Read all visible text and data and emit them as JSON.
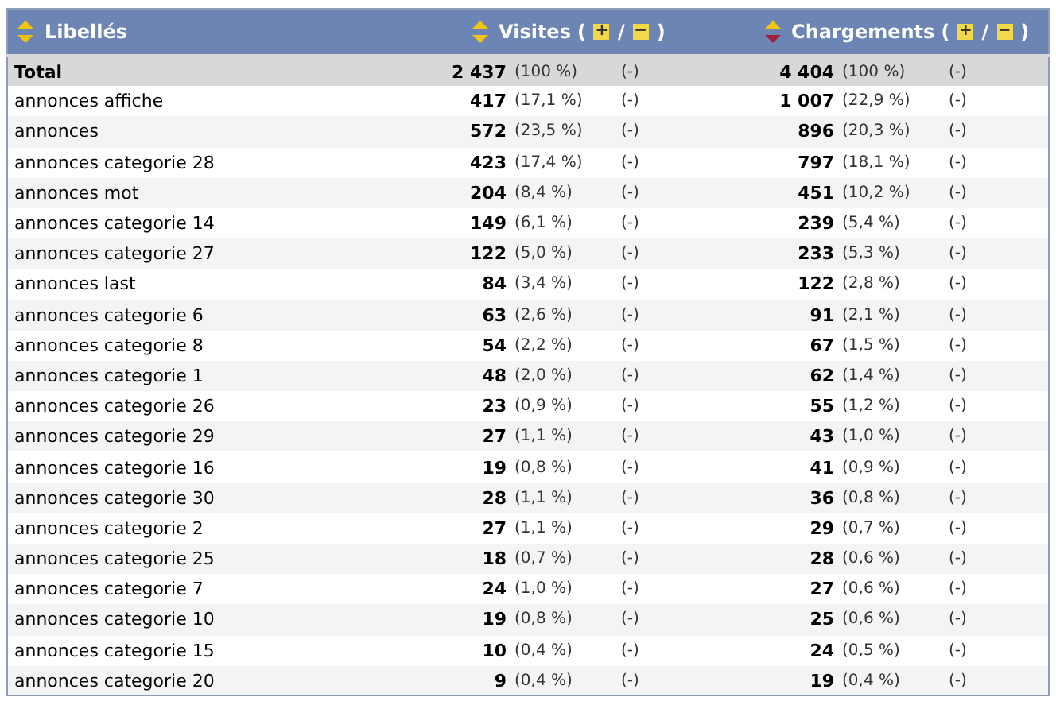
{
  "table": {
    "columns": [
      {
        "label": "Libellés",
        "sorted": false
      },
      {
        "label": "Visites",
        "sorted": false,
        "bracket_open": "(",
        "expand": "+",
        "separator": "/",
        "collapse": "−",
        "bracket_close": ")"
      },
      {
        "label": "Chargements",
        "sorted": true,
        "bracket_open": "(",
        "expand": "+",
        "separator": "/",
        "collapse": "−",
        "bracket_close": ")"
      }
    ],
    "rows": [
      {
        "kind": "total",
        "label": "Total",
        "visits": "2 437",
        "visits_pct": "(100 %)",
        "visits_delta": "(-)",
        "loads": "4 404",
        "loads_pct": "(100 %)",
        "loads_delta": "(-)"
      },
      {
        "kind": "item",
        "label": "annonces affiche",
        "visits": "417",
        "visits_pct": "(17,1 %)",
        "visits_delta": "(-)",
        "loads": "1 007",
        "loads_pct": "(22,9 %)",
        "loads_delta": "(-)"
      },
      {
        "kind": "item",
        "label": "annonces",
        "visits": "572",
        "visits_pct": "(23,5 %)",
        "visits_delta": "(-)",
        "loads": "896",
        "loads_pct": "(20,3 %)",
        "loads_delta": "(-)"
      },
      {
        "kind": "item",
        "label": "annonces categorie 28",
        "visits": "423",
        "visits_pct": "(17,4 %)",
        "visits_delta": "(-)",
        "loads": "797",
        "loads_pct": "(18,1 %)",
        "loads_delta": "(-)"
      },
      {
        "kind": "item",
        "label": "annonces mot",
        "visits": "204",
        "visits_pct": "(8,4 %)",
        "visits_delta": "(-)",
        "loads": "451",
        "loads_pct": "(10,2 %)",
        "loads_delta": "(-)"
      },
      {
        "kind": "item",
        "label": "annonces categorie 14",
        "visits": "149",
        "visits_pct": "(6,1 %)",
        "visits_delta": "(-)",
        "loads": "239",
        "loads_pct": "(5,4 %)",
        "loads_delta": "(-)"
      },
      {
        "kind": "item",
        "label": "annonces categorie 27",
        "visits": "122",
        "visits_pct": "(5,0 %)",
        "visits_delta": "(-)",
        "loads": "233",
        "loads_pct": "(5,3 %)",
        "loads_delta": "(-)"
      },
      {
        "kind": "item",
        "label": "annonces last",
        "visits": "84",
        "visits_pct": "(3,4 %)",
        "visits_delta": "(-)",
        "loads": "122",
        "loads_pct": "(2,8 %)",
        "loads_delta": "(-)"
      },
      {
        "kind": "item",
        "label": "annonces categorie 6",
        "visits": "63",
        "visits_pct": "(2,6 %)",
        "visits_delta": "(-)",
        "loads": "91",
        "loads_pct": "(2,1 %)",
        "loads_delta": "(-)"
      },
      {
        "kind": "item",
        "label": "annonces categorie 8",
        "visits": "54",
        "visits_pct": "(2,2 %)",
        "visits_delta": "(-)",
        "loads": "67",
        "loads_pct": "(1,5 %)",
        "loads_delta": "(-)"
      },
      {
        "kind": "item",
        "label": "annonces categorie 1",
        "visits": "48",
        "visits_pct": "(2,0 %)",
        "visits_delta": "(-)",
        "loads": "62",
        "loads_pct": "(1,4 %)",
        "loads_delta": "(-)"
      },
      {
        "kind": "item",
        "label": "annonces categorie 26",
        "visits": "23",
        "visits_pct": "(0,9 %)",
        "visits_delta": "(-)",
        "loads": "55",
        "loads_pct": "(1,2 %)",
        "loads_delta": "(-)"
      },
      {
        "kind": "item",
        "label": "annonces categorie 29",
        "visits": "27",
        "visits_pct": "(1,1 %)",
        "visits_delta": "(-)",
        "loads": "43",
        "loads_pct": "(1,0 %)",
        "loads_delta": "(-)"
      },
      {
        "kind": "item",
        "label": "annonces categorie 16",
        "visits": "19",
        "visits_pct": "(0,8 %)",
        "visits_delta": "(-)",
        "loads": "41",
        "loads_pct": "(0,9 %)",
        "loads_delta": "(-)"
      },
      {
        "kind": "item",
        "label": "annonces categorie 30",
        "visits": "28",
        "visits_pct": "(1,1 %)",
        "visits_delta": "(-)",
        "loads": "36",
        "loads_pct": "(0,8 %)",
        "loads_delta": "(-)"
      },
      {
        "kind": "item",
        "label": "annonces categorie 2",
        "visits": "27",
        "visits_pct": "(1,1 %)",
        "visits_delta": "(-)",
        "loads": "29",
        "loads_pct": "(0,7 %)",
        "loads_delta": "(-)"
      },
      {
        "kind": "item",
        "label": "annonces categorie 25",
        "visits": "18",
        "visits_pct": "(0,7 %)",
        "visits_delta": "(-)",
        "loads": "28",
        "loads_pct": "(0,6 %)",
        "loads_delta": "(-)"
      },
      {
        "kind": "item",
        "label": "annonces categorie 7",
        "visits": "24",
        "visits_pct": "(1,0 %)",
        "visits_delta": "(-)",
        "loads": "27",
        "loads_pct": "(0,6 %)",
        "loads_delta": "(-)"
      },
      {
        "kind": "item",
        "label": "annonces categorie 10",
        "visits": "19",
        "visits_pct": "(0,8 %)",
        "visits_delta": "(-)",
        "loads": "25",
        "loads_pct": "(0,6 %)",
        "loads_delta": "(-)"
      },
      {
        "kind": "item",
        "label": "annonces categorie 15",
        "visits": "10",
        "visits_pct": "(0,4 %)",
        "visits_delta": "(-)",
        "loads": "24",
        "loads_pct": "(0,5 %)",
        "loads_delta": "(-)"
      },
      {
        "kind": "item",
        "label": "annonces categorie 20",
        "visits": "9",
        "visits_pct": "(0,4 %)",
        "visits_delta": "(-)",
        "loads": "19",
        "loads_pct": "(0,4 %)",
        "loads_delta": "(-)"
      }
    ]
  }
}
